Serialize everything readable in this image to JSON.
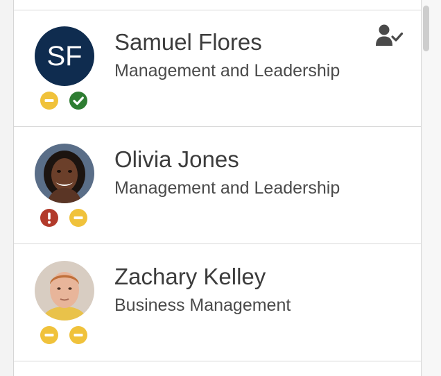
{
  "people": [
    {
      "name": "Samuel Flores",
      "department": "Management and Leadership",
      "avatar": {
        "kind": "initials",
        "initials": "SF",
        "bg_color": "#0f2c4f"
      },
      "statuses": [
        "minus-circle-icon",
        "check-circle-icon"
      ],
      "marked_user_icon": "user-check-icon"
    },
    {
      "name": "Olivia Jones",
      "department": "Management and Leadership",
      "avatar": {
        "kind": "photo"
      },
      "statuses": [
        "exclamation-circle-icon",
        "minus-circle-icon"
      ]
    },
    {
      "name": "Zachary Kelley",
      "department": "Business Management",
      "avatar": {
        "kind": "photo"
      },
      "statuses": [
        "minus-circle-icon",
        "minus-circle-icon"
      ]
    }
  ],
  "colors": {
    "status_minus": "#f0c23b",
    "status_check": "#2e7d32",
    "status_alert": "#b23a2b",
    "initials_bg": "#0f2c4f"
  }
}
